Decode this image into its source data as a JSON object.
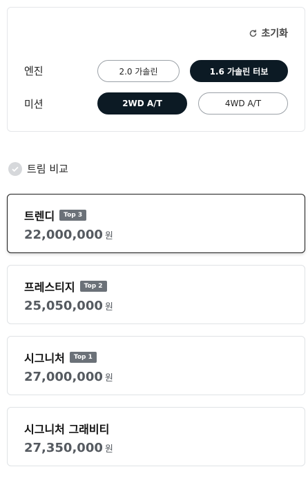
{
  "options": {
    "reset_label": "초기화",
    "engine": {
      "label": "엔진",
      "choices": [
        "2.0 가솔린",
        "1.6 가솔린 터보"
      ],
      "selected": "1.6 가솔린 터보"
    },
    "transmission": {
      "label": "미션",
      "choices": [
        "2WD A/T",
        "4WD A/T"
      ],
      "selected": "2WD A/T"
    }
  },
  "compare": {
    "label": "트림 비교"
  },
  "trims": [
    {
      "name": "트렌디",
      "badge": "Top 3",
      "price": "22,000,000",
      "unit": "원"
    },
    {
      "name": "프레스티지",
      "badge": "Top 2",
      "price": "25,050,000",
      "unit": "원"
    },
    {
      "name": "시그니처",
      "badge": "Top 1",
      "price": "27,000,000",
      "unit": "원"
    },
    {
      "name": "시그니처 그래비티",
      "price": "27,350,000",
      "unit": "원"
    }
  ]
}
